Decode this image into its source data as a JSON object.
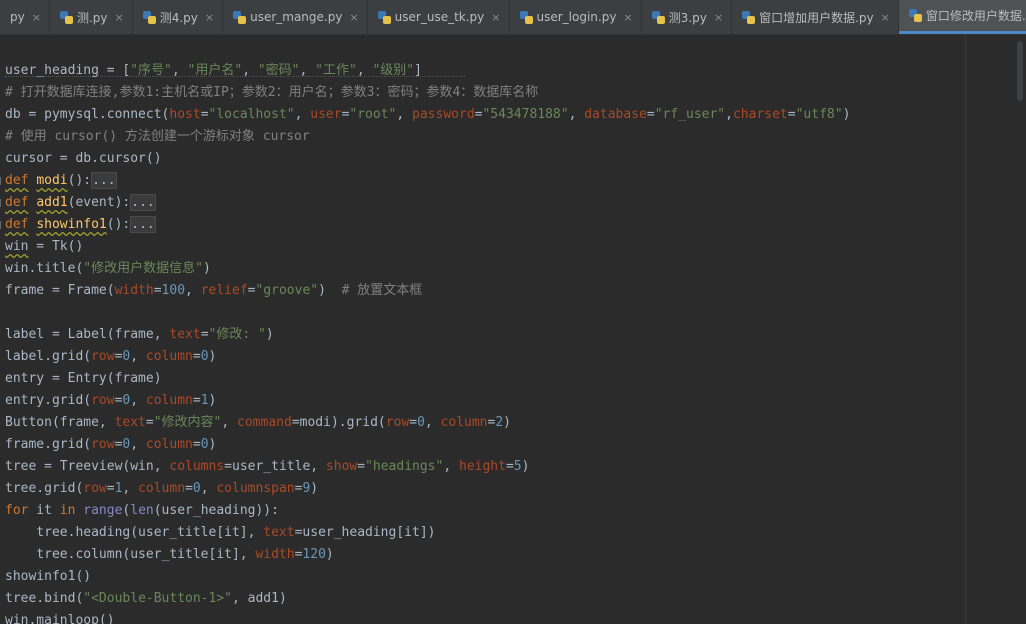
{
  "tabs": [
    {
      "label": "py",
      "active": false,
      "icon": false
    },
    {
      "label": "测.py",
      "active": false,
      "icon": true
    },
    {
      "label": "测4.py",
      "active": false,
      "icon": true
    },
    {
      "label": "user_mange.py",
      "active": false,
      "icon": true
    },
    {
      "label": "user_use_tk.py",
      "active": false,
      "icon": true
    },
    {
      "label": "user_login.py",
      "active": false,
      "icon": true
    },
    {
      "label": "测3.py",
      "active": false,
      "icon": true
    },
    {
      "label": "窗口增加用户数据.py",
      "active": false,
      "icon": true
    },
    {
      "label": "窗口修改用户数据.py",
      "active": true,
      "icon": true
    }
  ],
  "close_glyph": "×",
  "code_lines": [
    [
      [
        "user_heading = [",
        ""
      ],
      [
        "\"序号\"",
        "s"
      ],
      [
        ", ",
        ""
      ],
      [
        "\"用户名\"",
        "s"
      ],
      [
        ", ",
        ""
      ],
      [
        "\"密码\"",
        "s"
      ],
      [
        ", ",
        ""
      ],
      [
        "\"工作\"",
        "s"
      ],
      [
        ", ",
        ""
      ],
      [
        "\"级别\"",
        "s"
      ],
      [
        "]",
        ""
      ]
    ],
    [
      [
        "# 打开数据库连接,参数1:主机名或IP；参数2：用户名；参数3：密码；参数4：数据库名称",
        "c"
      ]
    ],
    [
      [
        "db = pymysql.connect(",
        ""
      ],
      [
        "host",
        "p"
      ],
      [
        "=",
        ""
      ],
      [
        "\"localhost\"",
        "s"
      ],
      [
        ", ",
        ""
      ],
      [
        "user",
        "p"
      ],
      [
        "=",
        ""
      ],
      [
        "\"root\"",
        "s"
      ],
      [
        ", ",
        ""
      ],
      [
        "password",
        "p"
      ],
      [
        "=",
        ""
      ],
      [
        "\"543478188\"",
        "s"
      ],
      [
        ", ",
        ""
      ],
      [
        "database",
        "p"
      ],
      [
        "=",
        ""
      ],
      [
        "\"rf_user\"",
        "s"
      ],
      [
        ",",
        ""
      ],
      [
        "charset",
        "p"
      ],
      [
        "=",
        ""
      ],
      [
        "\"utf8\"",
        "s"
      ],
      [
        ")",
        ""
      ]
    ],
    [
      [
        "# 使用 cursor() 方法创建一个游标对象 cursor",
        "c"
      ]
    ],
    [
      [
        "cursor = db.cursor()",
        ""
      ]
    ],
    [
      [
        "def",
        "k sq"
      ],
      [
        " ",
        ""
      ],
      [
        "modi",
        "f sq"
      ],
      [
        "():",
        ""
      ],
      [
        "...",
        "fold"
      ]
    ],
    [
      [
        "def",
        "k sq"
      ],
      [
        " ",
        ""
      ],
      [
        "add1",
        "f sq"
      ],
      [
        "(event):",
        ""
      ],
      [
        "...",
        "fold"
      ]
    ],
    [
      [
        "def",
        "k sq"
      ],
      [
        " ",
        ""
      ],
      [
        "showinfo1",
        "f sq"
      ],
      [
        "():",
        ""
      ],
      [
        "...",
        "fold"
      ]
    ],
    [
      [
        "win",
        "sq"
      ],
      [
        " = Tk()",
        ""
      ]
    ],
    [
      [
        "win.title(",
        ""
      ],
      [
        "\"修改用户数据信息\"",
        "s"
      ],
      [
        ")",
        ""
      ]
    ],
    [
      [
        "frame = Frame(",
        ""
      ],
      [
        "width",
        "p"
      ],
      [
        "=",
        ""
      ],
      [
        "100",
        "n"
      ],
      [
        ", ",
        ""
      ],
      [
        "relief",
        "p"
      ],
      [
        "=",
        ""
      ],
      [
        "\"groove\"",
        "s"
      ],
      [
        ")  ",
        ""
      ],
      [
        "# 放置文本框",
        "c"
      ]
    ],
    [
      [
        "",
        ""
      ]
    ],
    [
      [
        "label = Label(frame, ",
        ""
      ],
      [
        "text",
        "p"
      ],
      [
        "=",
        ""
      ],
      [
        "\"修改: \"",
        "s"
      ],
      [
        ")",
        ""
      ]
    ],
    [
      [
        "label.grid(",
        ""
      ],
      [
        "row",
        "p"
      ],
      [
        "=",
        ""
      ],
      [
        "0",
        "n"
      ],
      [
        ", ",
        ""
      ],
      [
        "column",
        "p"
      ],
      [
        "=",
        ""
      ],
      [
        "0",
        "n"
      ],
      [
        ")",
        ""
      ]
    ],
    [
      [
        "entry = Entry(frame)",
        ""
      ]
    ],
    [
      [
        "entry.grid(",
        ""
      ],
      [
        "row",
        "p"
      ],
      [
        "=",
        ""
      ],
      [
        "0",
        "n"
      ],
      [
        ", ",
        ""
      ],
      [
        "column",
        "p"
      ],
      [
        "=",
        ""
      ],
      [
        "1",
        "n"
      ],
      [
        ")",
        ""
      ]
    ],
    [
      [
        "Button(frame, ",
        ""
      ],
      [
        "text",
        "p"
      ],
      [
        "=",
        ""
      ],
      [
        "\"修改内容\"",
        "s"
      ],
      [
        ", ",
        ""
      ],
      [
        "command",
        "p"
      ],
      [
        "=modi).grid(",
        ""
      ],
      [
        "row",
        "p"
      ],
      [
        "=",
        ""
      ],
      [
        "0",
        "n"
      ],
      [
        ", ",
        ""
      ],
      [
        "column",
        "p"
      ],
      [
        "=",
        ""
      ],
      [
        "2",
        "n"
      ],
      [
        ")",
        ""
      ]
    ],
    [
      [
        "frame.grid(",
        ""
      ],
      [
        "row",
        "p"
      ],
      [
        "=",
        ""
      ],
      [
        "0",
        "n"
      ],
      [
        ", ",
        ""
      ],
      [
        "column",
        "p"
      ],
      [
        "=",
        ""
      ],
      [
        "0",
        "n"
      ],
      [
        ")",
        ""
      ]
    ],
    [
      [
        "tree = Treeview(win, ",
        ""
      ],
      [
        "columns",
        "p"
      ],
      [
        "=user_title, ",
        ""
      ],
      [
        "show",
        "p"
      ],
      [
        "=",
        ""
      ],
      [
        "\"headings\"",
        "s"
      ],
      [
        ", ",
        ""
      ],
      [
        "height",
        "p"
      ],
      [
        "=",
        ""
      ],
      [
        "5",
        "n"
      ],
      [
        ")",
        ""
      ]
    ],
    [
      [
        "tree.grid(",
        ""
      ],
      [
        "row",
        "p"
      ],
      [
        "=",
        ""
      ],
      [
        "1",
        "n"
      ],
      [
        ", ",
        ""
      ],
      [
        "column",
        "p"
      ],
      [
        "=",
        ""
      ],
      [
        "0",
        "n"
      ],
      [
        ", ",
        ""
      ],
      [
        "columnspan",
        "p"
      ],
      [
        "=",
        ""
      ],
      [
        "9",
        "n"
      ],
      [
        ")",
        ""
      ]
    ],
    [
      [
        "for",
        "k"
      ],
      [
        " it ",
        ""
      ],
      [
        "in",
        "k"
      ],
      [
        " ",
        ""
      ],
      [
        "range",
        "b"
      ],
      [
        "(",
        ""
      ],
      [
        "len",
        "b"
      ],
      [
        "(user_heading)):",
        ""
      ]
    ],
    [
      [
        "    tree.heading(user_title[it], ",
        ""
      ],
      [
        "text",
        "p"
      ],
      [
        "=user_heading[it])",
        ""
      ]
    ],
    [
      [
        "    tree.column(user_title[it], ",
        ""
      ],
      [
        "width",
        "p"
      ],
      [
        "=",
        ""
      ],
      [
        "120",
        "n"
      ],
      [
        ")",
        ""
      ]
    ],
    [
      [
        "showinfo1()",
        ""
      ]
    ],
    [
      [
        "tree.bind(",
        ""
      ],
      [
        "\"<Double-Button-1>\"",
        "s"
      ],
      [
        ", add1)",
        ""
      ]
    ],
    [
      [
        "win.mainloop()",
        ""
      ]
    ]
  ]
}
